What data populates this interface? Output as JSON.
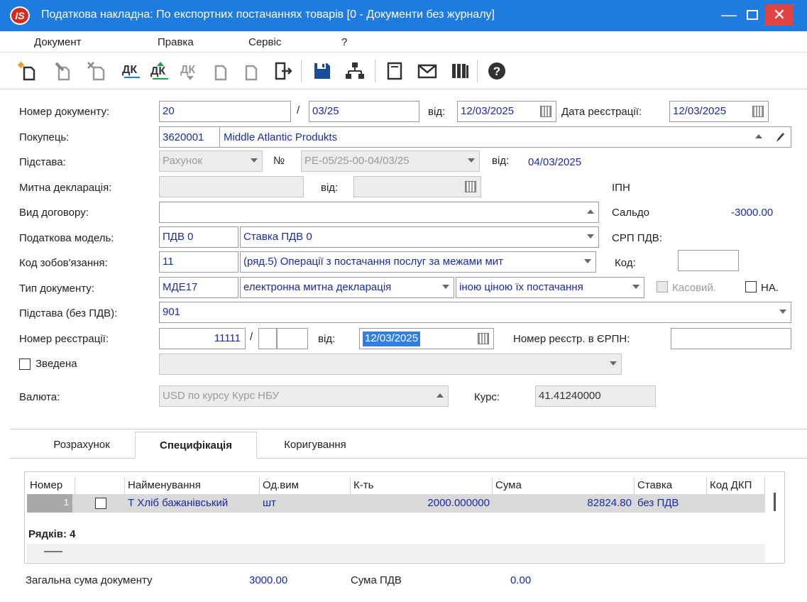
{
  "window": {
    "title": "Податкова накладна: По експортних  постачаннях товарів [0 - Документи без журналу]",
    "logo": "IS"
  },
  "menu": [
    "Документ",
    "Правка",
    "Сервіс",
    "?"
  ],
  "toolbar": [
    "new-doc-icon",
    "edit-doc-icon",
    "delete-doc-icon",
    "dk-icon",
    "dk-up-icon",
    "dk-down-icon",
    "copy-doc-icon",
    "paste-doc-icon",
    "exit-icon",
    "save-icon",
    "tree-icon",
    "form-icon",
    "mail-icon",
    "library-icon",
    "help-icon"
  ],
  "form": {
    "doc_number_label": "Номер документу:",
    "doc_number": "20",
    "doc_number_sep": "/",
    "doc_number_suffix": "03/25",
    "from_label": "від:",
    "doc_date": "12/03/2025",
    "reg_date_label": "Дата реєстрації:",
    "reg_date": "12/03/2025",
    "buyer_label": "Покупець:",
    "buyer_code": "3620001",
    "buyer_name": "Middle Atlantic Produkts",
    "basis_label": "Підстава:",
    "basis_type": "Рахунок",
    "basis_no_label": "№",
    "basis_no": "РЕ-05/25-00-04/03/25",
    "basis_from_label": "від:",
    "basis_date": "04/03/2025",
    "customs_label": "Митна декларація:",
    "customs_from_label": "від:",
    "ipn_label": "ІПН",
    "contract_label": "Вид договору:",
    "saldo_label": "Сальдо",
    "saldo": "-3000.00",
    "tax_model_label": "Податкова модель:",
    "tax_model_code": "ПДВ  0",
    "tax_model_name": "Ставка ПДВ 0",
    "srp_label": "СРП ПДВ:",
    "obligation_label": "Код зобов'язання:",
    "obligation_code": "11",
    "obligation_name": "(ряд.5) Операції з постачання послуг за межами мит",
    "code_label": "Код:",
    "doctype_label": "Тип документу:",
    "doctype_code": "МДЕ17",
    "doctype_name": "електронна митна декларація",
    "doctype_price": "іною ціною їх постачання",
    "cash_label": "Касовий.",
    "na_label": "НА.",
    "basis_novat_label": "Підстава (без ПДВ):",
    "basis_novat": "901",
    "reg_no_label": "Номер реєстрації:",
    "reg_no": "11111",
    "reg_no_sep": "/",
    "reg_from_label": "від:",
    "reg_no_date": "12/03/2025",
    "erpn_label": "Номер реєстр. в ЄРПН:",
    "consolidated_label": "Зведена",
    "currency_label": "Валюта:",
    "currency": "USD по курсу Курс НБУ",
    "rate_label": "Курс:",
    "rate": "41.41240000"
  },
  "tabs": [
    "Розрахунок",
    "Специфікація",
    "Коригування"
  ],
  "table": {
    "headers": [
      "Номер",
      "",
      "Найменування",
      "Од.вим",
      "К-ть",
      "Сума",
      "Ставка",
      "Код ДКП"
    ],
    "rows": [
      {
        "num": "1",
        "name": "Т Хліб бажанівський",
        "unit": "шт",
        "qty": "2000.000000",
        "sum": "82824.80",
        "rate": "без ПДВ"
      }
    ],
    "rows_count": "Рядків: 4"
  },
  "totals": {
    "total_label": "Загальна сума документу",
    "total": "3000.00",
    "vat_label": "Сума ПДВ",
    "vat": "0.00"
  }
}
